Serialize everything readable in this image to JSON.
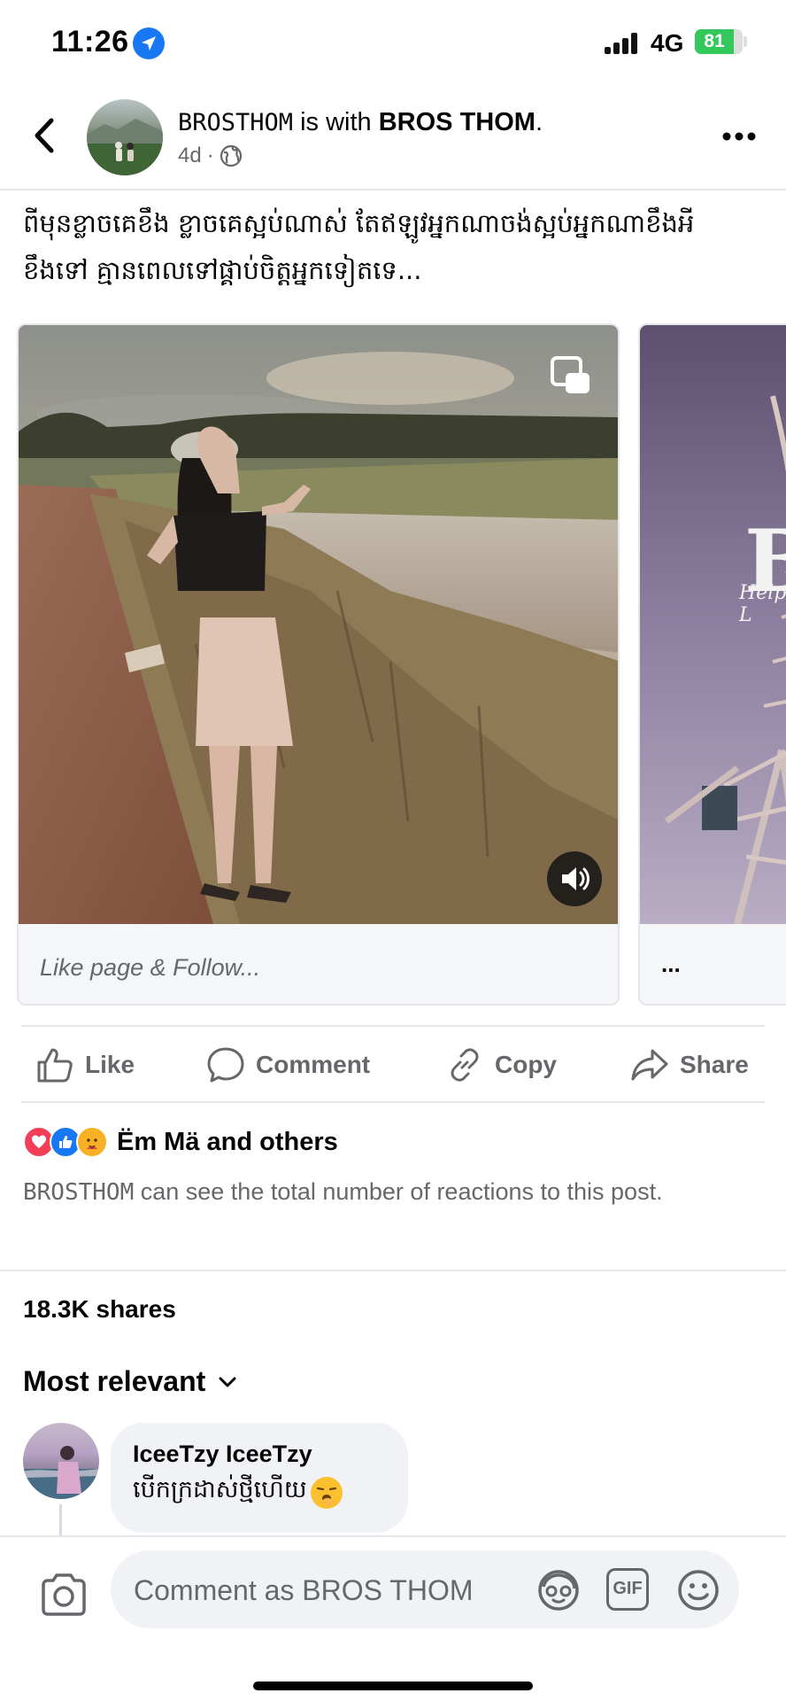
{
  "status_bar": {
    "time": "11:26",
    "network": "4G",
    "battery": "81",
    "battery_level": 0.81,
    "icons": [
      "location-arrow-icon",
      "signal-bars-icon",
      "battery-icon"
    ]
  },
  "header": {
    "page_name": "BROSTHOM",
    "with_text": " is with ",
    "tagged": "BROS THOM",
    "tagged_suffix": ".",
    "time_ago": "4d",
    "separator": "·",
    "icons": [
      "back-arrow-icon",
      "globe-icon",
      "more-options-icon"
    ]
  },
  "post": {
    "caption_line1": "ពីមុនខ្លាចគេខឹង ខ្លាចគេស្អប់ណាស់ តែឥឡូវអ្នកណាចង់ស្អប់អ្នកណាខឹងអី",
    "caption_line2": "ខឹងទៅ គ្មានពេលទៅផ្គាប់ចិត្តអ្នកទៀតទេ...",
    "cards": [
      {
        "caption": "Like page & Follow..."
      },
      {
        "caption": "...",
        "overlay_letter": "B",
        "overlay_sub": "Help L"
      }
    ]
  },
  "actions": {
    "like": "Like",
    "comment": "Comment",
    "copy": "Copy",
    "share": "Share"
  },
  "reactions": {
    "names": "Ëm Mä and others",
    "note_page": "BROSTHOM",
    "note_text": " can see the total number of reactions to this post."
  },
  "shares": "18.3K shares",
  "sort_label": "Most relevant",
  "comment": {
    "author": "IceeTzy IceeTzy",
    "text": "បើកក្រដាស់ថ្មីហើយ"
  },
  "composer": {
    "placeholder": "Comment as BROS THOM",
    "gif_label": "GIF"
  },
  "colors": {
    "accent": "#1877f2",
    "secondary_text": "#65676b",
    "battery": "#34c759"
  }
}
